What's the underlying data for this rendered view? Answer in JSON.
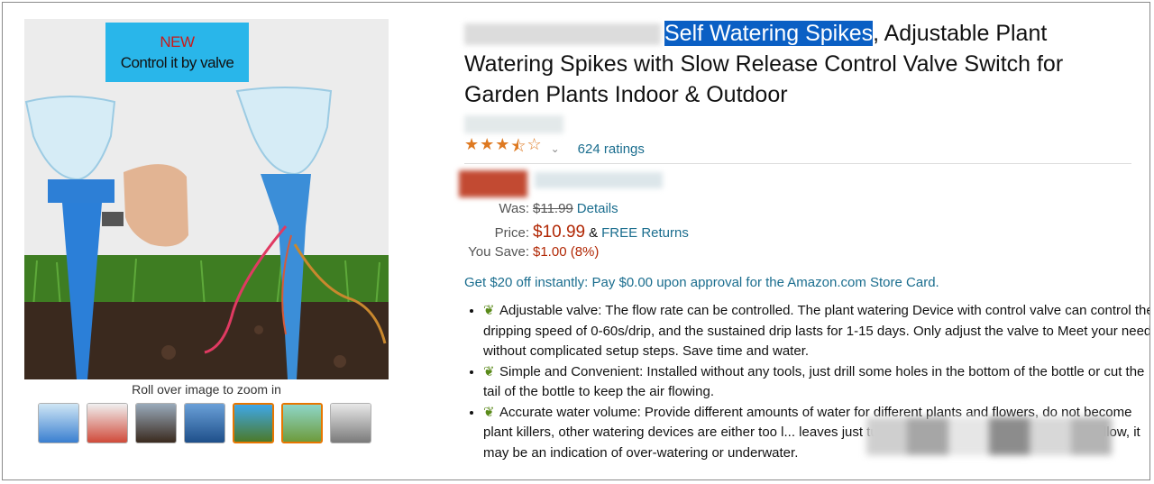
{
  "image_panel": {
    "badge_line1": "NEW",
    "badge_line2": "Control it by valve",
    "zoom_hint": "Roll over image to zoom in",
    "thumbnails": [
      {
        "name": "thumb-1",
        "active": false
      },
      {
        "name": "thumb-2",
        "active": false
      },
      {
        "name": "thumb-3",
        "active": false
      },
      {
        "name": "thumb-4",
        "active": false
      },
      {
        "name": "thumb-5",
        "active": true
      },
      {
        "name": "thumb-6",
        "active": true
      },
      {
        "name": "thumb-7",
        "active": false
      }
    ]
  },
  "product": {
    "title_highlight": "Self Watering Spikes",
    "title_rest": ", Adjustable Plant Watering Spikes with Slow Release Control Valve Switch for Garden Plants Indoor & Outdoor",
    "rating_stars": 3.5,
    "ratings_text": "624 ratings"
  },
  "pricing": {
    "was_label": "Was:",
    "was_value": "$11.99",
    "details_link": "Details",
    "price_label": "Price:",
    "price_value": "$10.99",
    "amp": "&",
    "free_returns": "FREE Returns",
    "save_label": "You Save:",
    "save_value": "$1.00 (8%)"
  },
  "card_offer": "Get $20 off instantly: Pay $0.00 upon approval for the Amazon.com Store Card.",
  "bullets": [
    "Adjustable valve: The flow rate can be controlled. The plant watering Device with control valve can control the dripping speed of 0-60s/drip, and the sustained drip lasts for 1-15 days. Only adjust the valve to Meet your needs without complicated setup steps. Save time and water.",
    "Simple and Convenient: Installed without any tools, just drill some holes in the bottom of the bottle or cut the tail of the bottle to keep the air flowing.",
    "Accurate water volume: Provide different amounts of water for different plants and flowers, do not become plant killers, other watering devices are either too l... leaves just turn yellow and fall but if new growth Yellow, it may be an indication of over-watering or underwater."
  ],
  "colors": {
    "link": "#1a6d8e",
    "price": "#b12704",
    "star": "#de7921",
    "highlight": "#0a5fc4"
  }
}
